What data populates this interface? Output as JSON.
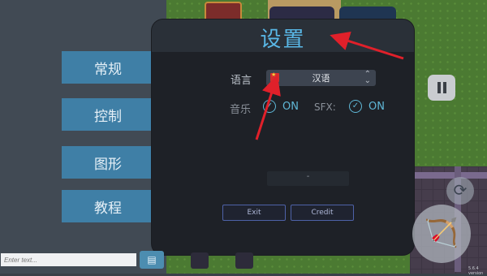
{
  "settings": {
    "title": "设置",
    "tabs": [
      {
        "label": "常规"
      },
      {
        "label": "控制"
      },
      {
        "label": "图形"
      },
      {
        "label": "教程"
      }
    ],
    "language": {
      "label": "语言",
      "value": "汉语",
      "flag_icon": "china-flag-icon"
    },
    "music": {
      "label": "音乐",
      "state": "ON"
    },
    "sfx": {
      "label": "SFX:",
      "state": "ON"
    },
    "version": "-",
    "buttons": {
      "exit": "Exit",
      "credit": "Credit"
    }
  },
  "chat": {
    "placeholder": "Enter text...",
    "send_icon": "chat-icon"
  },
  "hud": {
    "version_tag": "5.6.4 version"
  },
  "colors": {
    "accent": "#59b7e6",
    "tab_bg": "#3f7fa6",
    "annotation": "#e0202a"
  }
}
